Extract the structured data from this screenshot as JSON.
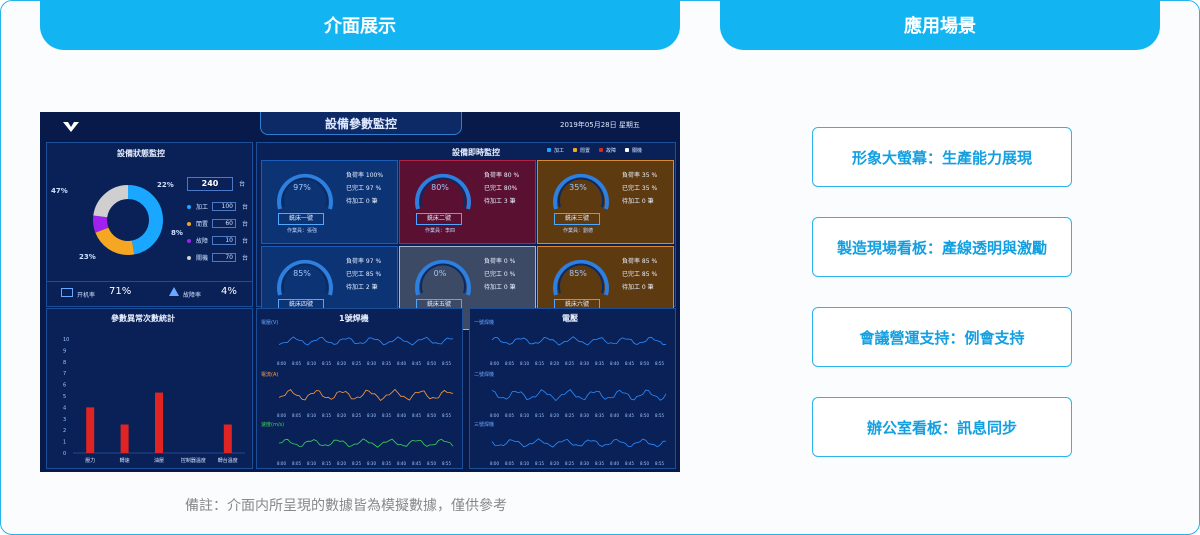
{
  "tabs": {
    "left": "介面展示",
    "right": "應用場景"
  },
  "footnote": "備註：介面内所呈現的數據皆為模擬數據，僅供參考",
  "scenes": [
    "形象大螢幕：生產能力展現",
    "製造現場看板：產線透明與激勵",
    "會議營運支持：例會支持",
    "辦公室看板：訊息同步"
  ],
  "dashboard": {
    "title": "設備參數監控",
    "date": "2019年05月28日 星期五",
    "status_panel": {
      "title": "設備狀態監控",
      "pct_process": "47%",
      "pct_idle": "22%",
      "pct_fault": "8%",
      "pct_shutdown": "23%",
      "total": "240",
      "unit": "台",
      "items": [
        {
          "label": "加工",
          "value": "100",
          "unit": "台",
          "color": "#1aa7ff"
        },
        {
          "label": "閒置",
          "value": "60",
          "unit": "台",
          "color": "#f5a623"
        },
        {
          "label": "故障",
          "value": "10",
          "unit": "台",
          "color": "#a020f0"
        },
        {
          "label": "關機",
          "value": "70",
          "unit": "台",
          "color": "#d0d0d0"
        }
      ],
      "startup_label": "开机率",
      "startup_rate": "71%",
      "fault_label": "故障率",
      "fault_rate": "4%"
    },
    "realtime_panel": {
      "title": "設備即時監控",
      "legend": [
        "加工",
        "閒置",
        "故障",
        "關機"
      ],
      "machines": [
        {
          "name": "銑床一號",
          "operator": "作業員：張強",
          "pct": "97%",
          "load": "負荷率 100%",
          "done": "已完工 97 %",
          "pending": "待加工  0  筆",
          "status": "blue"
        },
        {
          "name": "銑床二號",
          "operator": "作業員：李四",
          "pct": "80%",
          "load": "負荷率  80 %",
          "done": "已完工 80%",
          "pending": "待加工  3  筆",
          "status": "red"
        },
        {
          "name": "銑床三號",
          "operator": "作業員：劉德",
          "pct": "35%",
          "load": "負荷率  35 %",
          "done": "已完工  35 %",
          "pending": "待加工  0  筆",
          "status": "orange"
        },
        {
          "name": "銑床四號",
          "operator": "作業員：李剛",
          "pct": "85%",
          "load": "負荷率  97 %",
          "done": "已完工  85 %",
          "pending": "待加工  2  筆",
          "status": "blue"
        },
        {
          "name": "銑床五號",
          "operator": "作業員：李正",
          "pct": "0%",
          "load": "負荷率  0 %",
          "done": "已完工  0 %",
          "pending": "待加工  0  筆",
          "status": "gray"
        },
        {
          "name": "銑床六號",
          "operator": "作業員：黃慶",
          "pct": "85%",
          "load": "負荷率  85 %",
          "done": "已完工  85 %",
          "pending": "待加工  0  筆",
          "status": "orange"
        }
      ]
    },
    "abnormal_panel": {
      "title": "參數異常次數統計"
    },
    "welder_panel": {
      "title": "1號焊機",
      "l1": "電壓(V)",
      "l2": "電流(A)",
      "l3": "速度(m/s)"
    },
    "voltage_panel": {
      "title": "電壓",
      "l1": "一號焊機",
      "l2": "二號焊機",
      "l3": "三號焊機"
    }
  },
  "chart_data": {
    "type": "bar",
    "title": "參數異常次數統計",
    "categories": [
      "壓力",
      "轉速",
      "油壓",
      "控制器溫度",
      "轉台溫度"
    ],
    "values": [
      4,
      2.5,
      5.3,
      0,
      2.5
    ],
    "ylim": [
      0,
      10
    ],
    "yticks": [
      0,
      1,
      2,
      3,
      4,
      5,
      6,
      7,
      8,
      9,
      10
    ],
    "color": "#e02424"
  },
  "time_ticks": [
    "8:00",
    "8:05",
    "8:10",
    "8:15",
    "8:20",
    "8:25",
    "8:30",
    "8:35",
    "8:40",
    "8:45",
    "8:50",
    "8:55"
  ]
}
